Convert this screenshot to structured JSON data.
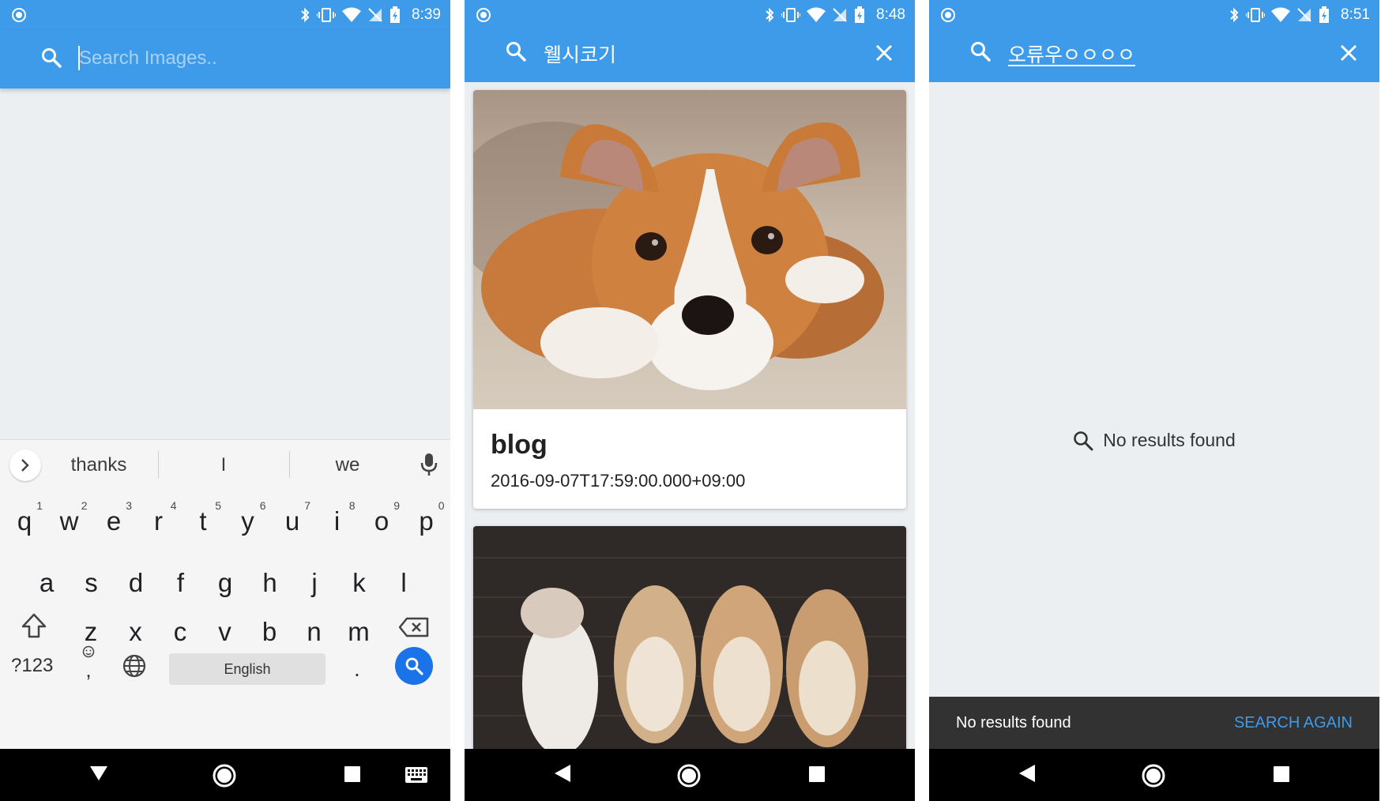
{
  "screens": [
    {
      "status_time": "8:39",
      "search": {
        "placeholder": "Search Images.."
      },
      "keyboard": {
        "suggestions": [
          "thanks",
          "I",
          "we"
        ],
        "row1": [
          {
            "k": "q",
            "h": "1"
          },
          {
            "k": "w",
            "h": "2"
          },
          {
            "k": "e",
            "h": "3"
          },
          {
            "k": "r",
            "h": "4"
          },
          {
            "k": "t",
            "h": "5"
          },
          {
            "k": "y",
            "h": "6"
          },
          {
            "k": "u",
            "h": "7"
          },
          {
            "k": "i",
            "h": "8"
          },
          {
            "k": "o",
            "h": "9"
          },
          {
            "k": "p",
            "h": "0"
          }
        ],
        "row2": [
          "a",
          "s",
          "d",
          "f",
          "g",
          "h",
          "j",
          "k",
          "l"
        ],
        "row3": [
          "z",
          "x",
          "c",
          "v",
          "b",
          "n",
          "m"
        ],
        "symbols_label": "?123",
        "emoji_label": ",",
        "space_label": "English",
        "period_label": "."
      }
    },
    {
      "status_time": "8:48",
      "search": {
        "query": "웰시코기"
      },
      "results": [
        {
          "title": "blog",
          "date": "2016-09-07T17:59:00.000+09:00"
        }
      ]
    },
    {
      "status_time": "8:51",
      "search": {
        "query": "오류우ㅇㅇㅇㅇ"
      },
      "empty_message": "No results found",
      "snackbar": {
        "message": "No results found",
        "action": "SEARCH AGAIN"
      }
    }
  ],
  "colors": {
    "primary": "#3d9be9",
    "background": "#eceff1",
    "snackbar": "#323232",
    "keyboard_accent": "#1a73e8"
  }
}
